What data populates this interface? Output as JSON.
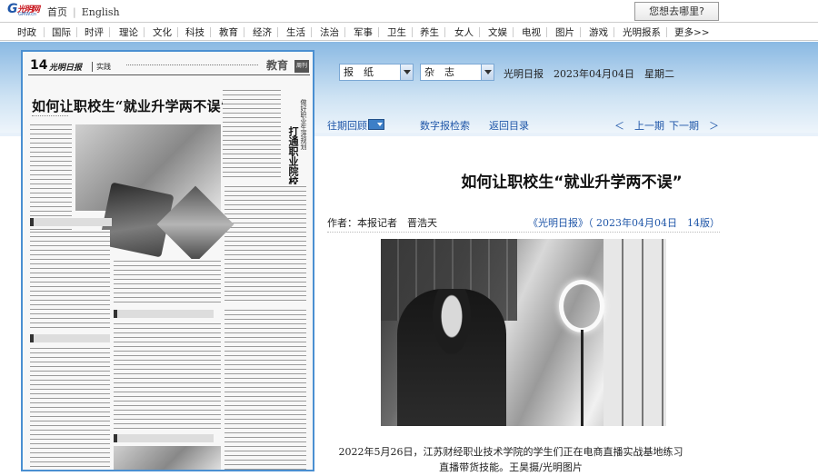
{
  "topbar": {
    "logo_letter": "G",
    "logo_script": "光明网",
    "logo_en": "GMW.cn",
    "links": [
      "首页",
      "English"
    ],
    "where_button": "您想去哪里?"
  },
  "nav": {
    "items": [
      "时政",
      "国际",
      "时评",
      "理论",
      "文化",
      "科技",
      "教育",
      "经济",
      "生活",
      "法治",
      "军事",
      "卫生",
      "养生",
      "女人",
      "文娱",
      "电视",
      "图片",
      "游戏",
      "光明报系",
      "更多>>"
    ]
  },
  "paper_preview": {
    "page_no": "14",
    "brand": "光明日报",
    "column": "实践",
    "section": "教育",
    "section_tag": "周刊",
    "headline": "如何让职校生“就业升学两不误”",
    "vertical_title": "打通职业院校就业“最后一公里”",
    "vertical_sub": "做好职业生涯规划"
  },
  "selectors": {
    "newspaper": "报　纸",
    "magazine": "杂　志"
  },
  "date_info": "光明日报　2023年04月04日　星期二",
  "toolbar": {
    "history": "往期回顾",
    "search": "数字报检索",
    "back": "返回目录",
    "prev": "＜　上一期",
    "next": "下一期　＞"
  },
  "article": {
    "title": "如何让职校生“就业升学两不误”",
    "author": "作者：本报记者　晋浩天",
    "source": "《光明日报》（ 2023年04月04日　14版）",
    "caption": "2022年5月26日，江苏财经职业技术学院的学生们正在电商直播实战基地练习直播带货技能。王昊摄/光明图片"
  }
}
